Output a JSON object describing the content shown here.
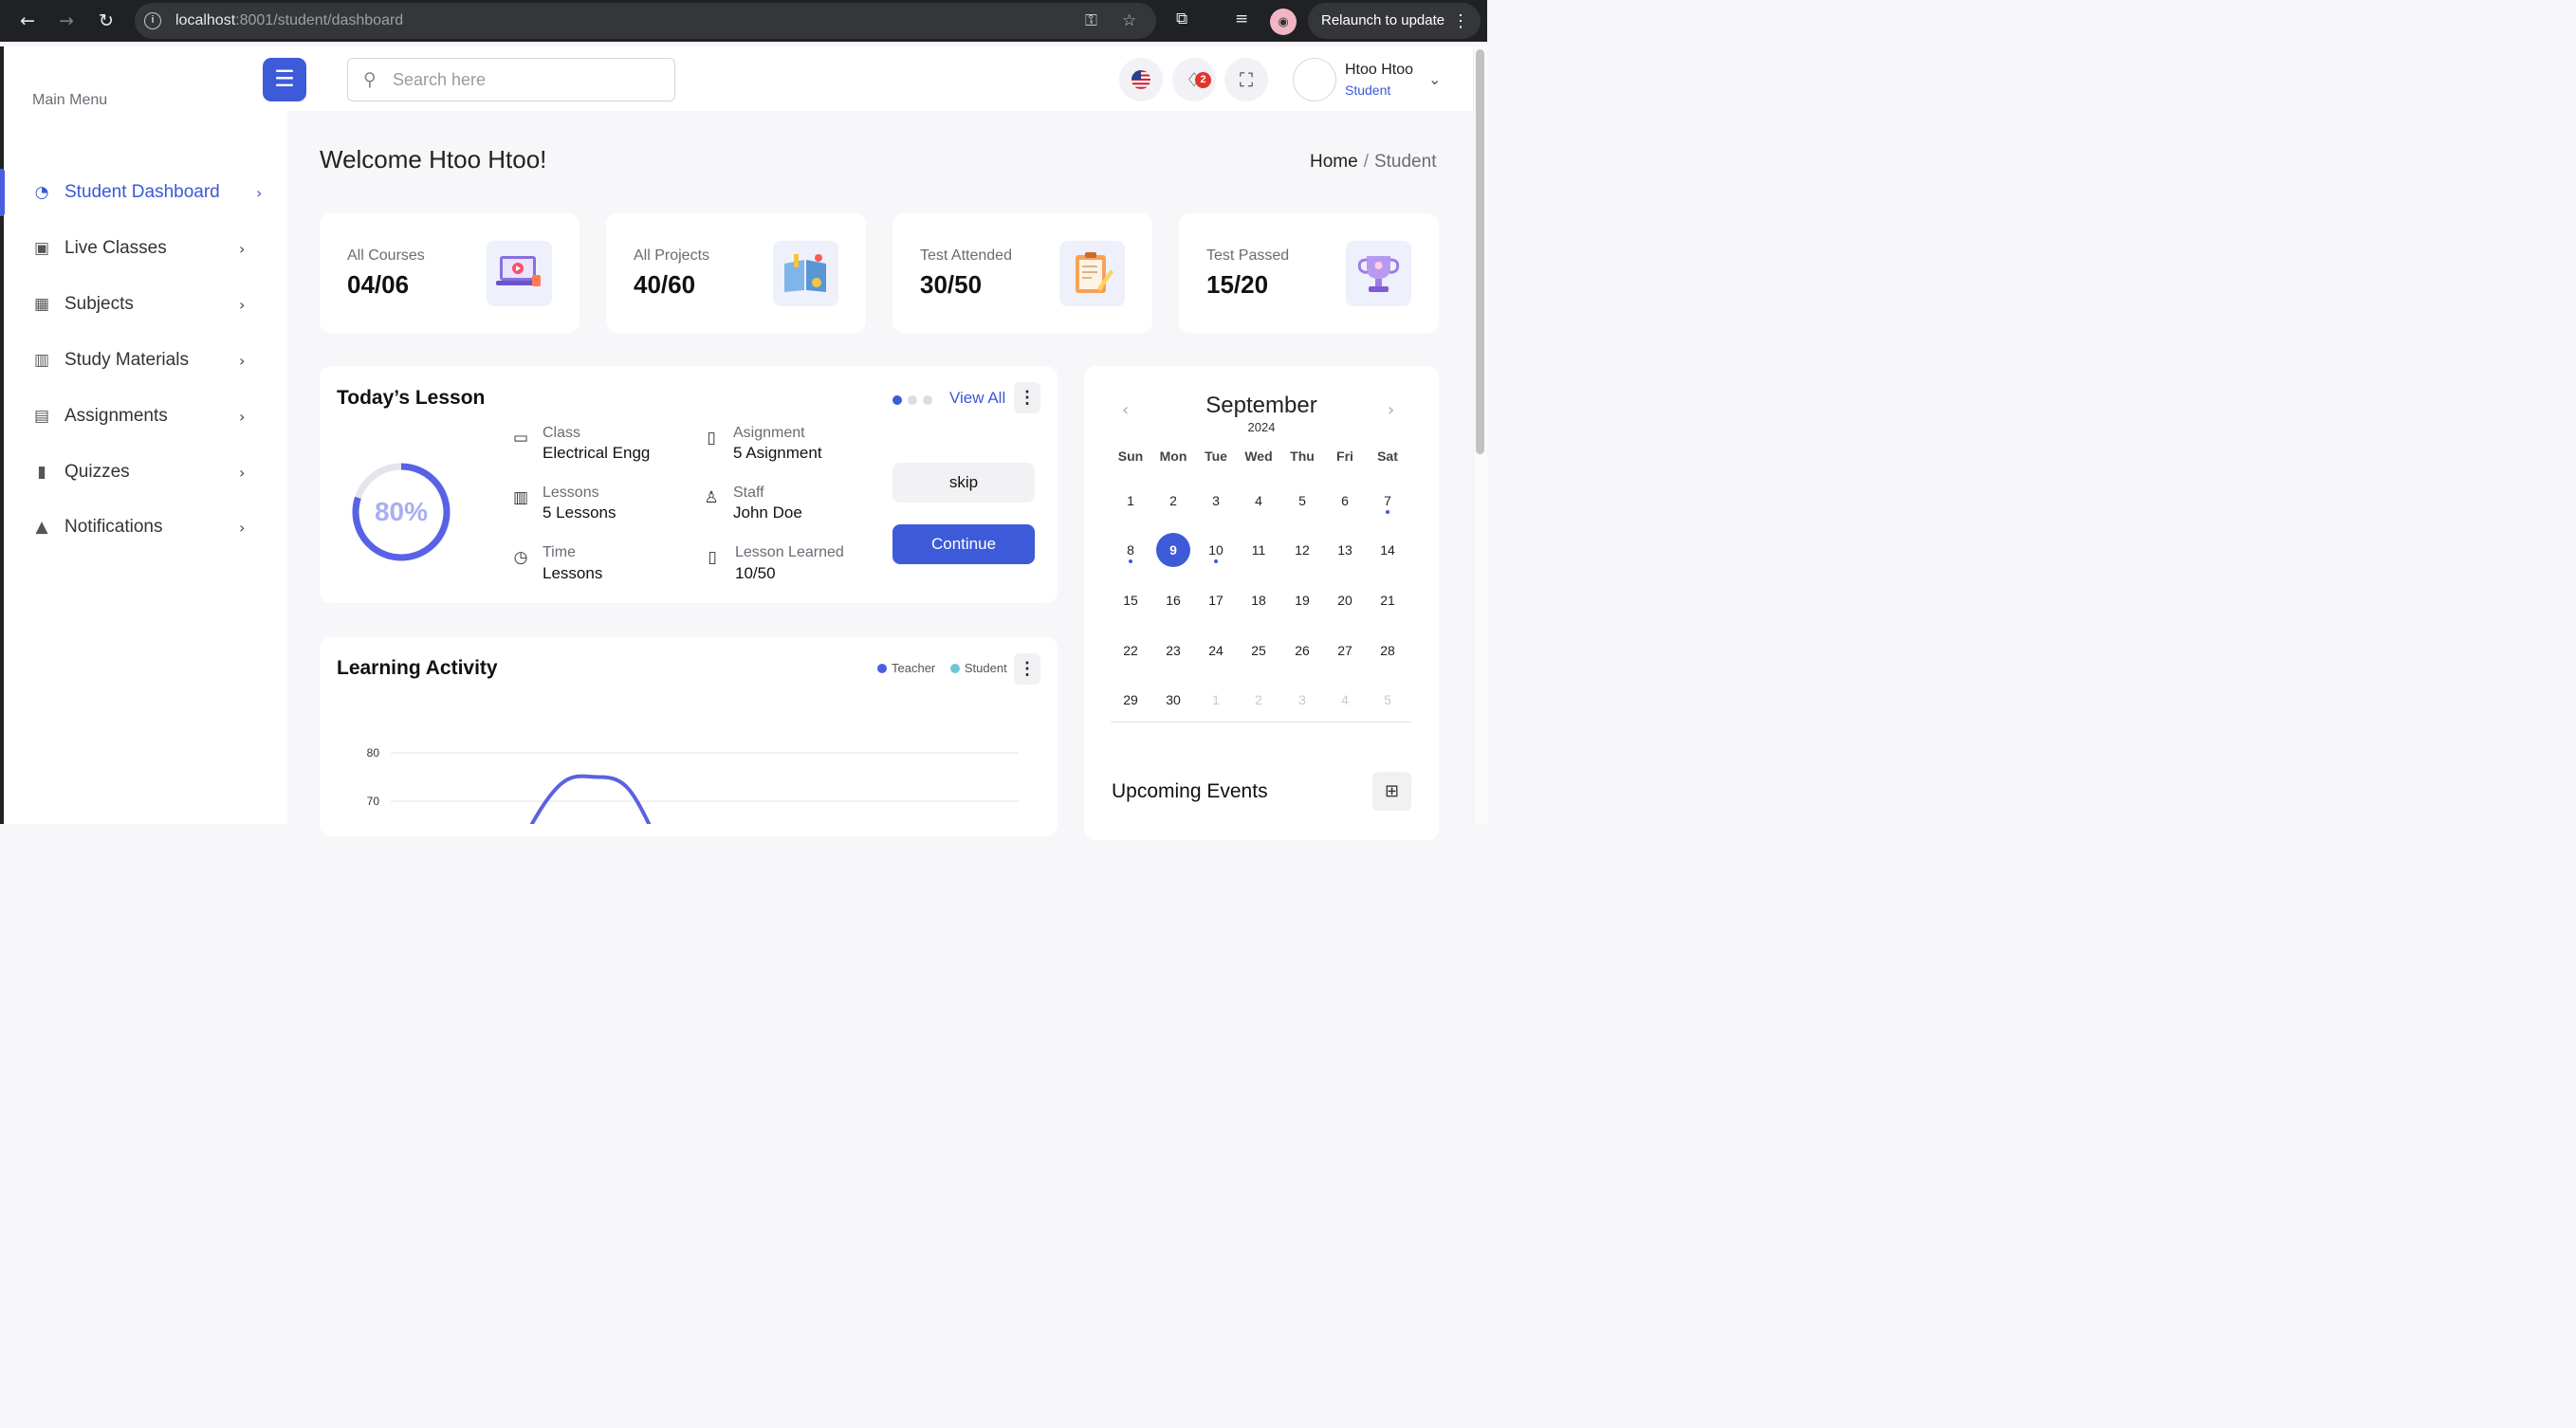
{
  "browser": {
    "url_host": "localhost",
    "url_path": ":8001/student/dashboard",
    "relaunch_label": "Relaunch to update"
  },
  "search": {
    "placeholder": "Search here"
  },
  "notifications_count": "2",
  "user": {
    "name": "Htoo Htoo",
    "role": "Student"
  },
  "sidebar": {
    "heading": "Main Menu",
    "items": [
      {
        "label": "Student Dashboard",
        "icon": "dashboard-gauge-icon",
        "active": true
      },
      {
        "label": "Live Classes",
        "icon": "chalkboard-teacher-icon"
      },
      {
        "label": "Subjects",
        "icon": "subjects-icon"
      },
      {
        "label": "Study Materials",
        "icon": "book-open-icon"
      },
      {
        "label": "Assignments",
        "icon": "assignment-icon"
      },
      {
        "label": "Quizzes",
        "icon": "clipboard-icon"
      },
      {
        "label": "Notifications",
        "icon": "bell-icon"
      }
    ]
  },
  "page": {
    "welcome": "Welcome Htoo Htoo!",
    "breadcrumb": {
      "home": "Home",
      "separator": "/",
      "current": "Student"
    }
  },
  "stats": [
    {
      "label": "All Courses",
      "value": "04/06",
      "icon": "laptop-video-icon"
    },
    {
      "label": "All Projects",
      "value": "40/60",
      "icon": "project-book-icon"
    },
    {
      "label": "Test Attended",
      "value": "30/50",
      "icon": "clipboard-pencil-icon"
    },
    {
      "label": "Test Passed",
      "value": "15/20",
      "icon": "trophy-icon"
    }
  ],
  "lesson": {
    "title": "Today’s Lesson",
    "view_all": "View All",
    "progress_text": "80%",
    "progress": 0.8,
    "details": [
      {
        "label": "Class",
        "value": "Electrical Engg",
        "icon": "monitor-icon"
      },
      {
        "label": "Asignment",
        "value": "5 Asignment",
        "icon": "clipboard-outline-icon"
      },
      {
        "label": "Lessons",
        "value": "5 Lessons",
        "icon": "open-book-icon"
      },
      {
        "label": "Staff",
        "value": "John Doe",
        "icon": "person-icon"
      },
      {
        "label": "Time",
        "value": "Lessons",
        "icon": "clock-icon"
      },
      {
        "label": "Lesson Learned",
        "value": "10/50",
        "icon": "book-icon"
      }
    ],
    "skip_label": "skip",
    "continue_label": "Continue"
  },
  "activity": {
    "title": "Learning Activity",
    "legend": [
      {
        "name": "Teacher",
        "color": "#4a5fe0"
      },
      {
        "name": "Student",
        "color": "#6ec6d8"
      }
    ]
  },
  "chart_data": {
    "type": "line",
    "title": "Learning Activity",
    "y_ticks": [
      80,
      70
    ],
    "ylim": [
      70,
      80
    ],
    "grid": true,
    "legend_position": "top-right",
    "series": [
      {
        "name": "Teacher",
        "color": "#5a62e0",
        "note": "visible portion: rises from below 70 to a peak of ~75 then falls below 70",
        "values": [
          65,
          75,
          65
        ]
      }
    ]
  },
  "calendar": {
    "month": "September",
    "year": "2024",
    "weekdays": [
      "Sun",
      "Mon",
      "Tue",
      "Wed",
      "Thu",
      "Fri",
      "Sat"
    ],
    "weeks": [
      [
        "1",
        "2",
        "3",
        "4",
        "5",
        "6",
        "7"
      ],
      [
        "8",
        "9",
        "10",
        "11",
        "12",
        "13",
        "14"
      ],
      [
        "15",
        "16",
        "17",
        "18",
        "19",
        "20",
        "21"
      ],
      [
        "22",
        "23",
        "24",
        "25",
        "26",
        "27",
        "28"
      ],
      [
        "29",
        "30",
        "1",
        "2",
        "3",
        "4",
        "5"
      ]
    ],
    "selected": "9",
    "event_days": [
      "7",
      "8",
      "10"
    ]
  },
  "events": {
    "title": "Upcoming Events"
  }
}
